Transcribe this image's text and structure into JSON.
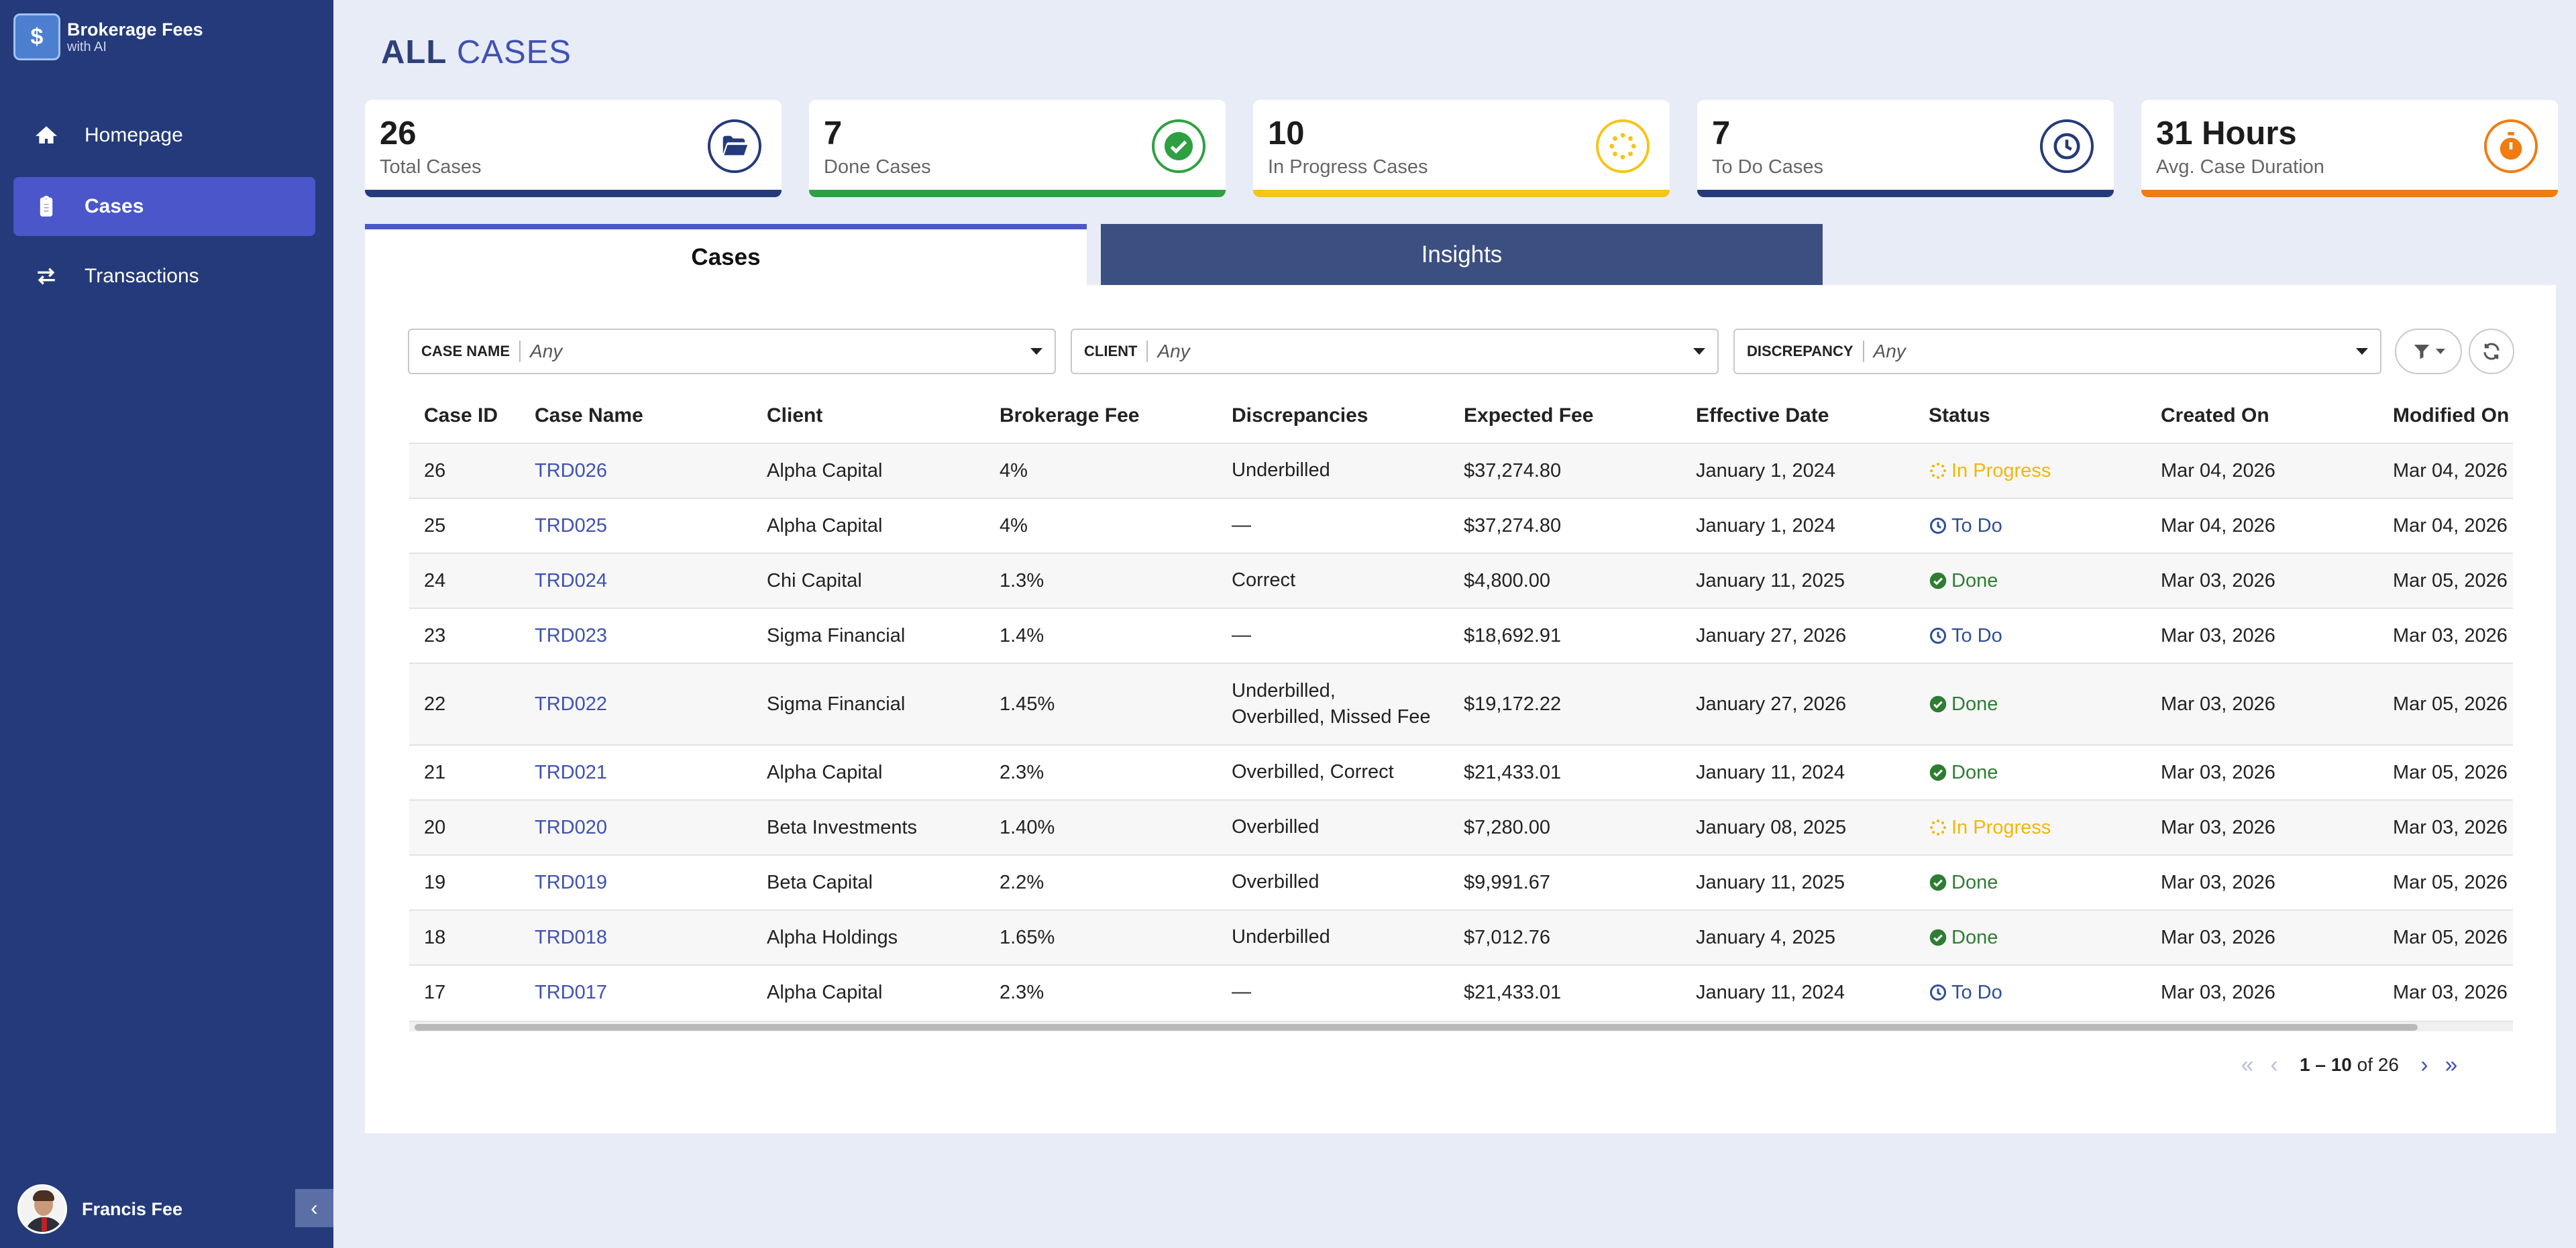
{
  "app": {
    "logo_title": "Brokerage Fees",
    "logo_sub": "with AI"
  },
  "nav": [
    {
      "label": "Homepage",
      "icon": "home-icon"
    },
    {
      "label": "Cases",
      "icon": "clipboard-icon"
    },
    {
      "label": "Transactions",
      "icon": "arrows-swap-icon"
    }
  ],
  "user": {
    "name": "Francis Fee"
  },
  "page": {
    "title_bold": "ALL",
    "title_light": "CASES"
  },
  "stats": [
    {
      "value": "26",
      "label": "Total Cases",
      "color": "#243a7a",
      "icon": "folder-open-icon"
    },
    {
      "value": "7",
      "label": "Done Cases",
      "color": "#2ea043",
      "icon": "check-circle-icon"
    },
    {
      "value": "10",
      "label": "In Progress Cases",
      "color": "#f5c518",
      "icon": "spinner-icon"
    },
    {
      "value": "7",
      "label": "To Do Cases",
      "color": "#243a7a",
      "icon": "clock-icon"
    },
    {
      "value": "31 Hours",
      "label": "Avg. Case Duration",
      "color": "#f07c12",
      "icon": "stopwatch-icon"
    }
  ],
  "tabs": {
    "cases": "Cases",
    "insights": "Insights"
  },
  "filters": [
    {
      "label": "CASE NAME",
      "value": "Any"
    },
    {
      "label": "CLIENT",
      "value": "Any"
    },
    {
      "label": "DISCREPANCY",
      "value": "Any"
    }
  ],
  "table": {
    "headers": [
      "Case ID",
      "Case Name",
      "Client",
      "Brokerage Fee",
      "Discrepancies",
      "Expected Fee",
      "Effective Date",
      "Status",
      "Created On",
      "Modified On"
    ],
    "rows": [
      [
        "26",
        "TRD026",
        "Alpha Capital",
        "4%",
        "Underbilled",
        "$37,274.80",
        "January 1, 2024",
        "In Progress",
        "Mar 04, 2026",
        "Mar 04, 2026"
      ],
      [
        "25",
        "TRD025",
        "Alpha Capital",
        "4%",
        "—",
        "$37,274.80",
        "January 1, 2024",
        "To Do",
        "Mar 04, 2026",
        "Mar 04, 2026"
      ],
      [
        "24",
        "TRD024",
        "Chi Capital",
        "1.3%",
        "Correct",
        "$4,800.00",
        "January 11, 2025",
        "Done",
        "Mar 03, 2026",
        "Mar 05, 2026"
      ],
      [
        "23",
        "TRD023",
        "Sigma Financial",
        "1.4%",
        "—",
        "$18,692.91",
        "January 27, 2026",
        "To Do",
        "Mar 03, 2026",
        "Mar 03, 2026"
      ],
      [
        "22",
        "TRD022",
        "Sigma Financial",
        "1.45%",
        "Underbilled,\nOverbilled, Missed Fee",
        "$19,172.22",
        "January 27, 2026",
        "Done",
        "Mar 03, 2026",
        "Mar 05, 2026"
      ],
      [
        "21",
        "TRD021",
        "Alpha Capital",
        "2.3%",
        "Overbilled, Correct",
        "$21,433.01",
        "January 11, 2024",
        "Done",
        "Mar 03, 2026",
        "Mar 05, 2026"
      ],
      [
        "20",
        "TRD020",
        "Beta Investments",
        "1.40%",
        "Overbilled",
        "$7,280.00",
        "January 08, 2025",
        "In Progress",
        "Mar 03, 2026",
        "Mar 03, 2026"
      ],
      [
        "19",
        "TRD019",
        "Beta Capital",
        "2.2%",
        "Overbilled",
        "$9,991.67",
        "January 11, 2025",
        "Done",
        "Mar 03, 2026",
        "Mar 05, 2026"
      ],
      [
        "18",
        "TRD018",
        "Alpha Holdings",
        "1.65%",
        "Underbilled",
        "$7,012.76",
        "January 4, 2025",
        "Done",
        "Mar 03, 2026",
        "Mar 05, 2026"
      ],
      [
        "17",
        "TRD017",
        "Alpha Capital",
        "2.3%",
        "—",
        "$21,433.01",
        "January 11, 2024",
        "To Do",
        "Mar 03, 2026",
        "Mar 03, 2026"
      ]
    ]
  },
  "pagination": {
    "range": "1 – 10",
    "of": "of",
    "total": "26"
  }
}
